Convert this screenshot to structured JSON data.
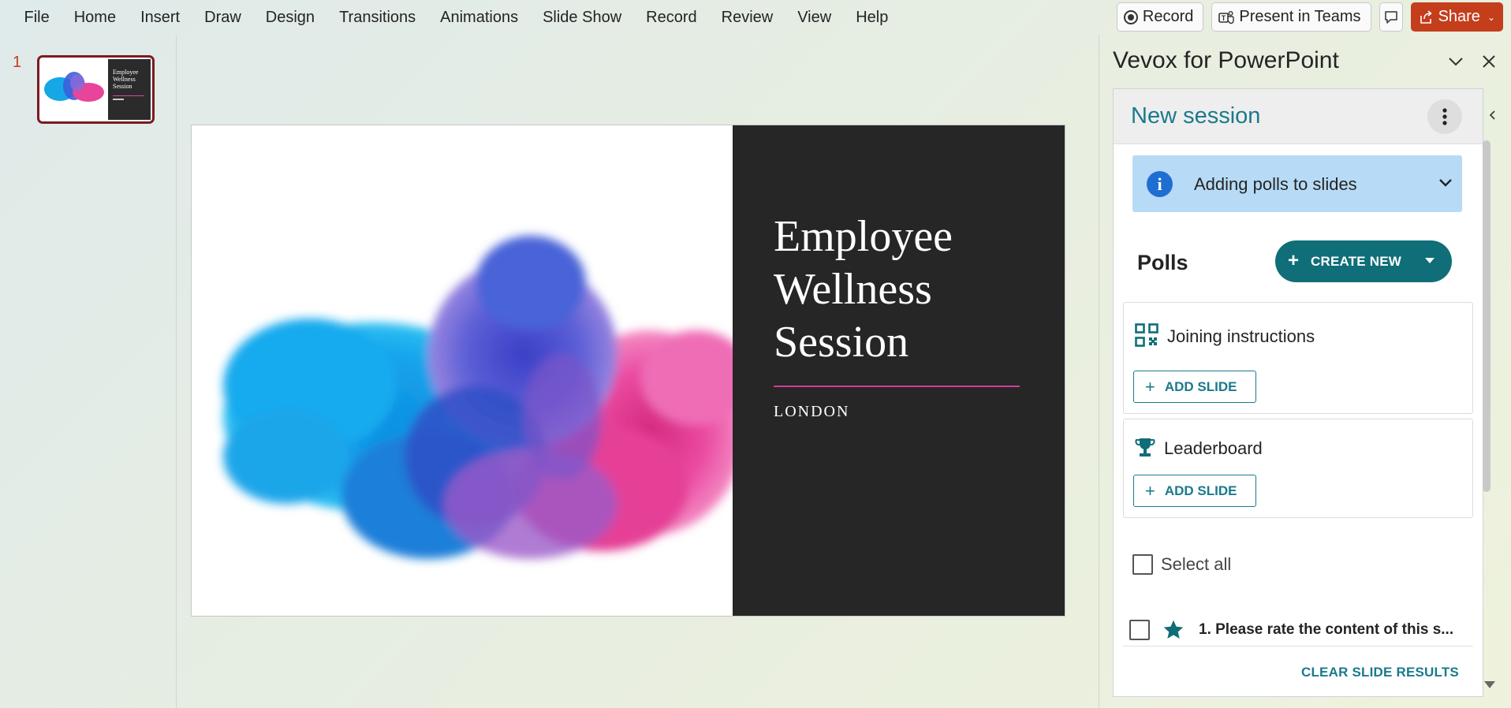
{
  "menu": {
    "items": [
      "File",
      "Home",
      "Insert",
      "Draw",
      "Design",
      "Transitions",
      "Animations",
      "Slide Show",
      "Record",
      "Review",
      "View",
      "Help"
    ],
    "record_label": "Record",
    "present_label": "Present in Teams",
    "share_label": "Share"
  },
  "thumbnails": {
    "slide_number": "1",
    "title": "Employee Wellness Session"
  },
  "slide": {
    "title": "Employee Wellness Session",
    "subtitle": "LONDON"
  },
  "task_pane": {
    "title": "Vevox for PowerPoint",
    "session_title": "New session",
    "info_text": "Adding polls to slides",
    "polls_label": "Polls",
    "create_label": "CREATE NEW",
    "cards": [
      {
        "title": "Joining instructions",
        "button": "ADD SLIDE",
        "icon": "qr-code-icon"
      },
      {
        "title": "Leaderboard",
        "button": "ADD SLIDE",
        "icon": "trophy-icon"
      }
    ],
    "select_all_label": "Select all",
    "poll_item": "1. Please rate the content of this s...",
    "clear_label": "CLEAR SLIDE RESULTS"
  },
  "colors": {
    "accent_teal": "#0f6e78",
    "share_orange": "#c43e1c",
    "info_blue": "#b7dbf6",
    "slide_dark": "#262626",
    "slide_rule": "#d23c95"
  }
}
